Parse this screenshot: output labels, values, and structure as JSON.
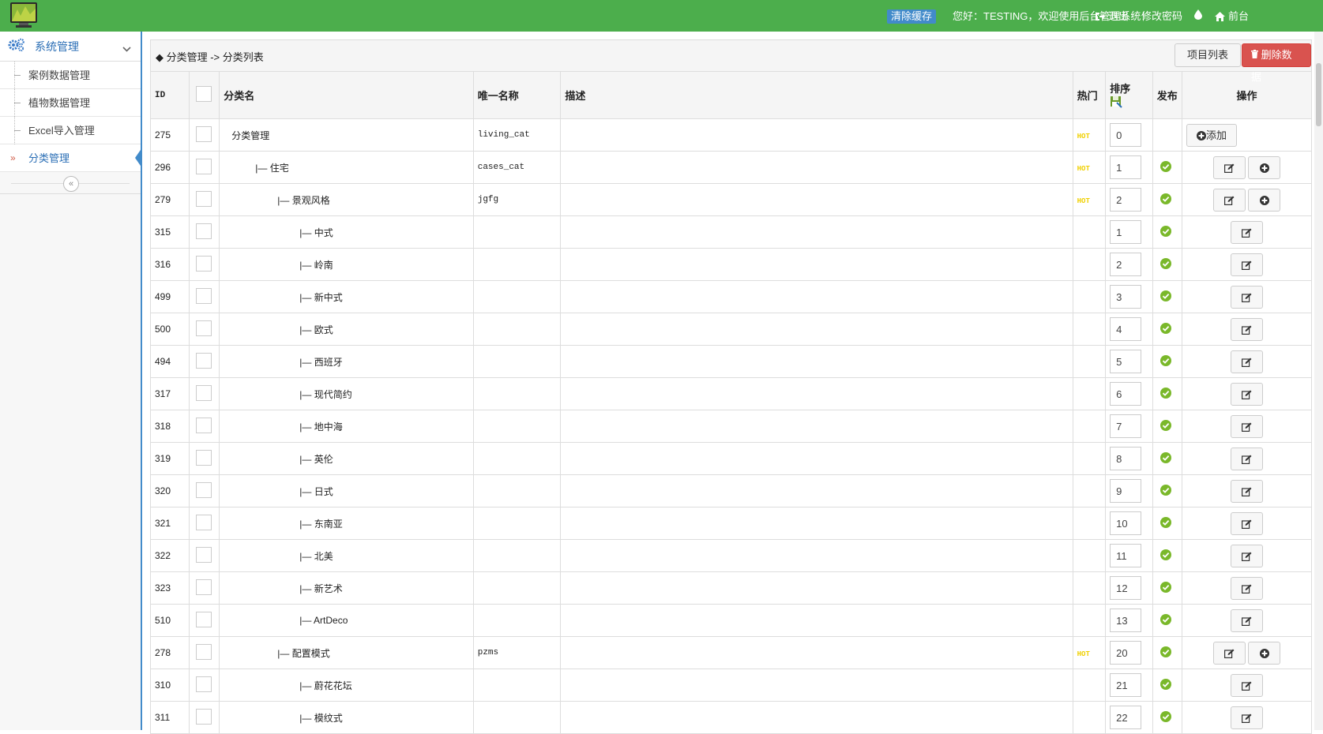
{
  "topbar": {
    "clear_cache": "清除缓存",
    "welcome": "您好：TESTING，欢迎使用后台管理系统！",
    "logout": "退出",
    "change_password": "修改密码",
    "frontend": "前台"
  },
  "sidebar": {
    "section_title": "系统管理",
    "items": [
      {
        "label": "案例数据管理"
      },
      {
        "label": "植物数据管理"
      },
      {
        "label": "Excel导入管理"
      },
      {
        "label": "分类管理"
      }
    ]
  },
  "breadcrumb": {
    "text": "◆ 分类管理 -> 分类列表"
  },
  "toolbar": {
    "list_label": "项目列表",
    "delete_label": "删除数据"
  },
  "table": {
    "headers": {
      "id": "ID",
      "name": "分类名",
      "unique": "唯一名称",
      "desc": "描述",
      "hot": "热门",
      "sort": "排序",
      "publish": "发布",
      "ops": "操作"
    },
    "add_label": "添加",
    "hot_label": "HOT",
    "rows": [
      {
        "id": "275",
        "name": "分类管理",
        "level": 0,
        "unique": "living_cat",
        "hot": true,
        "sort": "0",
        "published": false,
        "ops": "add"
      },
      {
        "id": "296",
        "name": "|— 住宅",
        "level": 1,
        "unique": "cases_cat",
        "hot": true,
        "sort": "1",
        "published": true,
        "ops": "edit_plus"
      },
      {
        "id": "279",
        "name": "|— 景观风格",
        "level": 2,
        "unique": "jgfg",
        "hot": true,
        "sort": "2",
        "published": true,
        "ops": "edit_plus"
      },
      {
        "id": "315",
        "name": "|— 中式",
        "level": 3,
        "unique": "",
        "hot": false,
        "sort": "1",
        "published": true,
        "ops": "edit"
      },
      {
        "id": "316",
        "name": "|— 岭南",
        "level": 3,
        "unique": "",
        "hot": false,
        "sort": "2",
        "published": true,
        "ops": "edit"
      },
      {
        "id": "499",
        "name": "|— 新中式",
        "level": 3,
        "unique": "",
        "hot": false,
        "sort": "3",
        "published": true,
        "ops": "edit"
      },
      {
        "id": "500",
        "name": "|— 欧式",
        "level": 3,
        "unique": "",
        "hot": false,
        "sort": "4",
        "published": true,
        "ops": "edit"
      },
      {
        "id": "494",
        "name": "|— 西班牙",
        "level": 3,
        "unique": "",
        "hot": false,
        "sort": "5",
        "published": true,
        "ops": "edit"
      },
      {
        "id": "317",
        "name": "|— 现代简约",
        "level": 3,
        "unique": "",
        "hot": false,
        "sort": "6",
        "published": true,
        "ops": "edit"
      },
      {
        "id": "318",
        "name": "|— 地中海",
        "level": 3,
        "unique": "",
        "hot": false,
        "sort": "7",
        "published": true,
        "ops": "edit"
      },
      {
        "id": "319",
        "name": "|— 英伦",
        "level": 3,
        "unique": "",
        "hot": false,
        "sort": "8",
        "published": true,
        "ops": "edit"
      },
      {
        "id": "320",
        "name": "|— 日式",
        "level": 3,
        "unique": "",
        "hot": false,
        "sort": "9",
        "published": true,
        "ops": "edit"
      },
      {
        "id": "321",
        "name": "|— 东南亚",
        "level": 3,
        "unique": "",
        "hot": false,
        "sort": "10",
        "published": true,
        "ops": "edit"
      },
      {
        "id": "322",
        "name": "|— 北美",
        "level": 3,
        "unique": "",
        "hot": false,
        "sort": "11",
        "published": true,
        "ops": "edit"
      },
      {
        "id": "323",
        "name": "|— 新艺术",
        "level": 3,
        "unique": "",
        "hot": false,
        "sort": "12",
        "published": true,
        "ops": "edit"
      },
      {
        "id": "510",
        "name": "|— ArtDeco",
        "level": 3,
        "unique": "",
        "hot": false,
        "sort": "13",
        "published": true,
        "ops": "edit"
      },
      {
        "id": "278",
        "name": "|— 配置模式",
        "level": 2,
        "unique": "pzms",
        "hot": true,
        "sort": "20",
        "published": true,
        "ops": "edit_plus"
      },
      {
        "id": "310",
        "name": "|— 蔚花花坛",
        "level": 3,
        "unique": "",
        "hot": false,
        "sort": "21",
        "published": true,
        "ops": "edit"
      },
      {
        "id": "311",
        "name": "|— 模纹式",
        "level": 3,
        "unique": "",
        "hot": false,
        "sort": "22",
        "published": true,
        "ops": "edit"
      }
    ]
  },
  "colors": {
    "topbar": "#4cae4c",
    "accent": "#428bca",
    "danger": "#d9534f",
    "publish": "#7ab82a",
    "hot": "#f0d000"
  }
}
